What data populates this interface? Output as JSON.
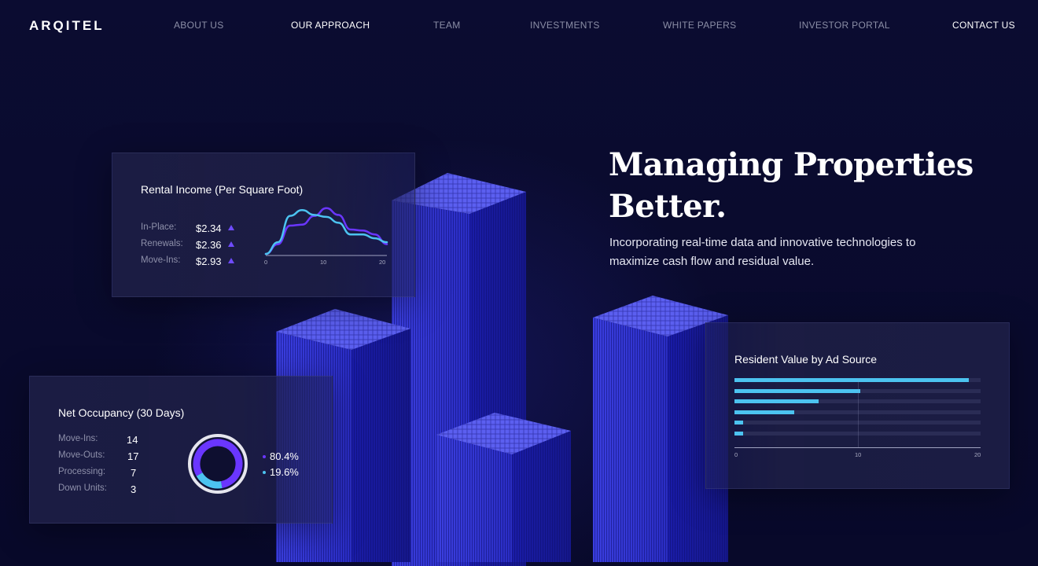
{
  "nav": {
    "logo": "ARQITEL",
    "links": [
      {
        "label": "ABOUT US"
      },
      {
        "label": "OUR APPROACH"
      },
      {
        "label": "TEAM"
      },
      {
        "label": "INVESTMENTS"
      },
      {
        "label": "WHITE PAPERS"
      },
      {
        "label": "INVESTOR PORTAL"
      },
      {
        "label": "CONTACT US"
      }
    ]
  },
  "hero": {
    "title_line1": "Managing Properties",
    "title_line2": "Better.",
    "subtitle_line1": "Incorporating real-time data and innovative technologies to",
    "subtitle_line2": "maximize cash flow and residual value."
  },
  "rental_card": {
    "title": "Rental Income (Per Square Foot)",
    "rows": [
      {
        "label": "In-Place:",
        "value": "$2.34"
      },
      {
        "label": "Renewals:",
        "value": "$2.36"
      },
      {
        "label": "Move-Ins:",
        "value": "$2.93"
      }
    ],
    "axis_ticks": [
      "0",
      "10",
      "20"
    ]
  },
  "occupancy_card": {
    "title": "Net Occupancy (30 Days)",
    "rows": [
      {
        "label": "Move-Ins:",
        "value": "14"
      },
      {
        "label": "Move-Outs:",
        "value": "17"
      },
      {
        "label": "Processing:",
        "value": "7"
      },
      {
        "label": "Down Units:",
        "value": "3"
      }
    ],
    "legend": [
      {
        "value": "80.4%",
        "color": "#6a36ff"
      },
      {
        "value": "19.6%",
        "color": "#4cc3f0"
      }
    ]
  },
  "resident_card": {
    "title": "Resident Value by Ad Source",
    "axis_ticks": [
      "0",
      "10",
      "20"
    ]
  },
  "chart_data": [
    {
      "type": "line",
      "x": [
        0,
        2,
        4,
        6,
        8,
        10,
        12,
        14,
        16,
        18,
        20
      ],
      "series": [
        {
          "values": [
            0.0,
            1.0,
            2.9,
            3.0,
            3.9,
            4.7,
            4.0,
            2.5,
            2.4,
            2.0,
            1.0
          ]
        },
        {
          "values": [
            0.0,
            1.2,
            3.9,
            4.5,
            4.0,
            3.8,
            3.2,
            2.0,
            2.0,
            1.6,
            1.2
          ]
        }
      ],
      "xlim": [
        0,
        20
      ],
      "colors": [
        "#6a36ff",
        "#4cc3f0"
      ]
    },
    {
      "type": "pie",
      "values": [
        80.4,
        19.6
      ],
      "colors": [
        "#6a36ff",
        "#4cc3f0"
      ]
    },
    {
      "type": "bar",
      "orientation": "horizontal",
      "values": [
        19.5,
        10.5,
        7.0,
        5.0,
        0.7,
        0.7
      ],
      "max": 20.5,
      "xlim": [
        0,
        20
      ],
      "color": "#4cc3f0"
    }
  ]
}
